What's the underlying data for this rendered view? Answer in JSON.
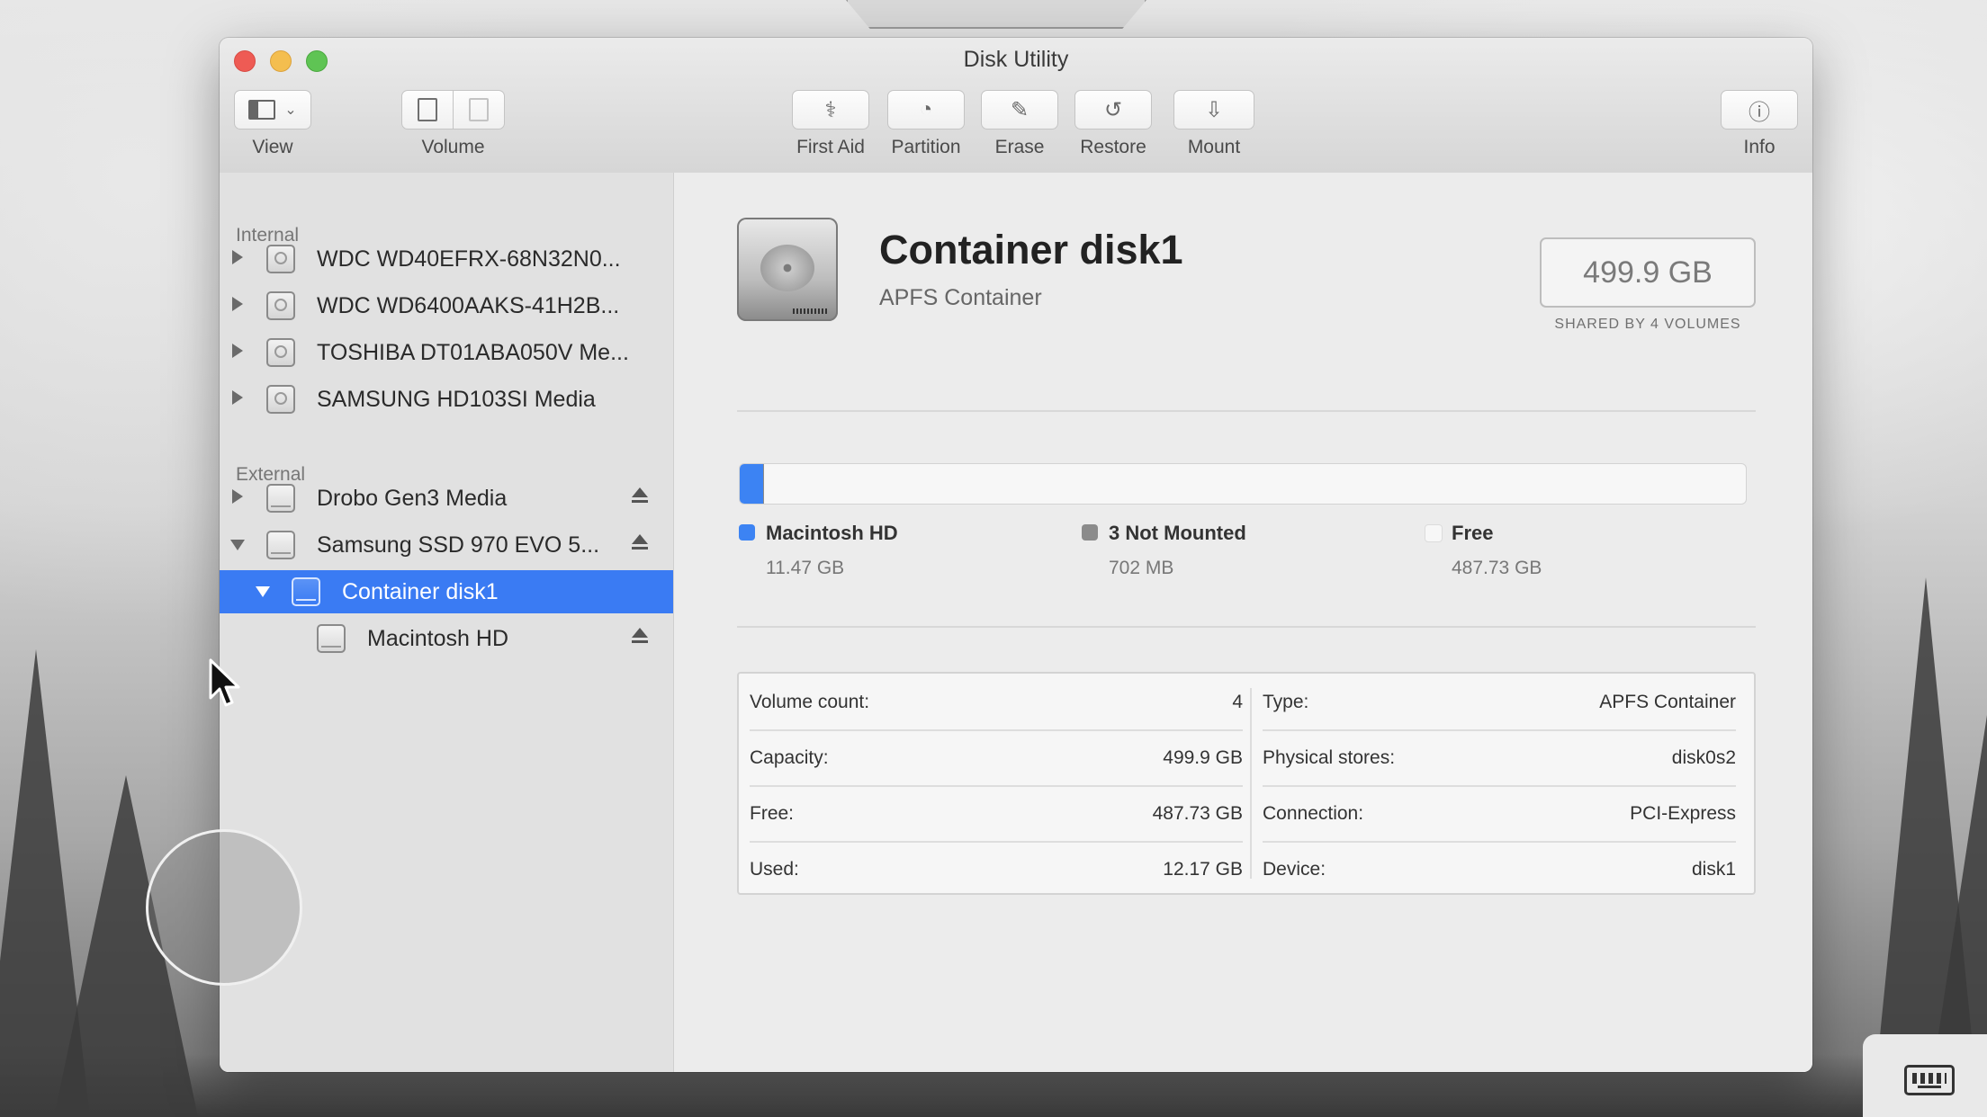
{
  "window": {
    "title": "Disk Utility"
  },
  "toolbar": {
    "view_label": "View",
    "volume_label": "Volume",
    "first_aid_label": "First Aid",
    "partition_label": "Partition",
    "erase_label": "Erase",
    "restore_label": "Restore",
    "mount_label": "Mount",
    "info_label": "Info"
  },
  "sidebar": {
    "internal_title": "Internal",
    "external_title": "External",
    "internal_items": [
      {
        "label": "WDC WD40EFRX-68N32N0..."
      },
      {
        "label": "WDC WD6400AAKS-41H2B..."
      },
      {
        "label": "TOSHIBA DT01ABA050V Me..."
      },
      {
        "label": "SAMSUNG HD103SI Media"
      }
    ],
    "external_items": [
      {
        "label": "Drobo Gen3 Media"
      },
      {
        "label": "Samsung SSD 970 EVO 5..."
      },
      {
        "label": "Container disk1"
      },
      {
        "label": "Macintosh HD"
      }
    ]
  },
  "detail": {
    "name": "Container disk1",
    "type": "APFS Container",
    "size": "499.9 GB",
    "shared_note": "SHARED BY 4 VOLUMES",
    "usage": [
      {
        "name": "Macintosh HD",
        "value": "11.47 GB",
        "color": "#3c83f3",
        "fraction": 0.0229
      },
      {
        "name": "3 Not Mounted",
        "value": "702 MB",
        "color": "#8b8b8b",
        "fraction": 0.0014
      },
      {
        "name": "Free",
        "value": "487.73 GB",
        "color": "#f7f7f7",
        "fraction": 0.9757
      }
    ],
    "info_left": [
      {
        "key": "Volume count:",
        "value": "4"
      },
      {
        "key": "Capacity:",
        "value": "499.9 GB"
      },
      {
        "key": "Free:",
        "value": "487.73 GB"
      },
      {
        "key": "Used:",
        "value": "12.17 GB"
      }
    ],
    "info_right": [
      {
        "key": "Type:",
        "value": "APFS Container"
      },
      {
        "key": "Physical stores:",
        "value": "disk0s2"
      },
      {
        "key": "Connection:",
        "value": "PCI-Express"
      },
      {
        "key": "Device:",
        "value": "disk1"
      }
    ]
  }
}
